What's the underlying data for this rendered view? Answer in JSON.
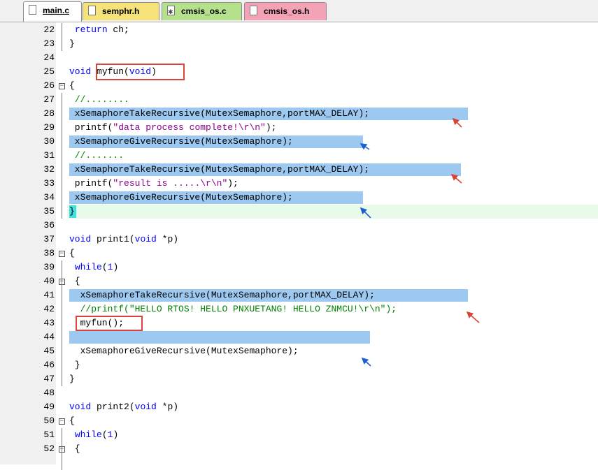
{
  "tabs": [
    {
      "label": "main.c",
      "icon": "file-icon",
      "active": true,
      "color": "#ffffff"
    },
    {
      "label": "semphr.h",
      "icon": "file-icon",
      "active": false,
      "color": "#f5e37a"
    },
    {
      "label": "cmsis_os.c",
      "icon": "gear-file-icon",
      "active": false,
      "color": "#b5e08c"
    },
    {
      "label": "cmsis_os.h",
      "icon": "file-icon",
      "active": false,
      "color": "#f4a3b6"
    }
  ],
  "lines": [
    {
      "n": "22",
      "text": " return ch;"
    },
    {
      "n": "23",
      "text": "}"
    },
    {
      "n": "24",
      "text": ""
    },
    {
      "n": "25",
      "text": "void myfun(void)"
    },
    {
      "n": "26",
      "text": "{"
    },
    {
      "n": "27",
      "text": " //........"
    },
    {
      "n": "28",
      "text": " xSemaphoreTakeRecursive(MutexSemaphore,portMAX_DELAY);"
    },
    {
      "n": "29",
      "text": " printf(\"data process complete!\\r\\n\");"
    },
    {
      "n": "30",
      "text": " xSemaphoreGiveRecursive(MutexSemaphore);"
    },
    {
      "n": "31",
      "text": " //......."
    },
    {
      "n": "32",
      "text": " xSemaphoreTakeRecursive(MutexSemaphore,portMAX_DELAY);"
    },
    {
      "n": "33",
      "text": " printf(\"result is .....\\r\\n\");"
    },
    {
      "n": "34",
      "text": " xSemaphoreGiveRecursive(MutexSemaphore);"
    },
    {
      "n": "35",
      "text": "}"
    },
    {
      "n": "36",
      "text": ""
    },
    {
      "n": "37",
      "text": "void print1(void *p)"
    },
    {
      "n": "38",
      "text": "{"
    },
    {
      "n": "39",
      "text": " while(1)"
    },
    {
      "n": "40",
      "text": " {"
    },
    {
      "n": "41",
      "text": "  xSemaphoreTakeRecursive(MutexSemaphore,portMAX_DELAY);"
    },
    {
      "n": "42",
      "text": "  //printf(\"HELLO RTOS! HELLO PNXUETANG! HELLO ZNMCU!\\r\\n\");"
    },
    {
      "n": "43",
      "text": "  myfun();"
    },
    {
      "n": "44",
      "text": ""
    },
    {
      "n": "45",
      "text": "  xSemaphoreGiveRecursive(MutexSemaphore);"
    },
    {
      "n": "46",
      "text": " }"
    },
    {
      "n": "47",
      "text": "}"
    },
    {
      "n": "48",
      "text": ""
    },
    {
      "n": "49",
      "text": "void print2(void *p)"
    },
    {
      "n": "50",
      "text": "{"
    },
    {
      "n": "51",
      "text": " while(1)"
    },
    {
      "n": "52",
      "text": " {"
    }
  ],
  "colors": {
    "highlight": "#9dc8f0",
    "cursor_line": "#e8fbe8",
    "red_annotation": "#d9443a",
    "blue_annotation": "#1e5fd0",
    "keyword": "#0000ff",
    "string": "#8b008b",
    "comment": "#008000"
  }
}
